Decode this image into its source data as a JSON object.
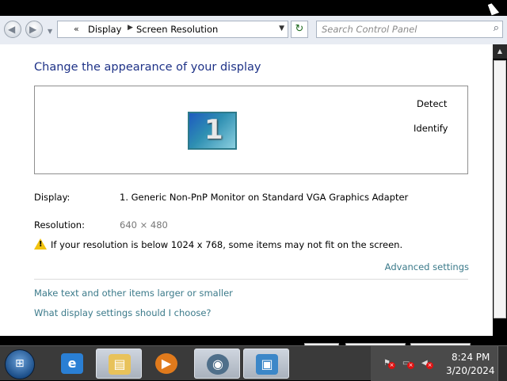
{
  "address_bar": {
    "chevrons": "«",
    "breadcrumbs": [
      "Display",
      "Screen Resolution"
    ],
    "search_placeholder": "Search Control Panel"
  },
  "main": {
    "heading": "Change the appearance of your display",
    "preview": {
      "monitor_number": "1",
      "detect_label": "Detect",
      "identify_label": "Identify"
    },
    "display_label": "Display:",
    "display_value": "1. Generic Non-PnP Monitor on Standard VGA Graphics Adapter",
    "resolution_label": "Resolution:",
    "resolution_value": "640 × 480",
    "warning": "If your resolution is below 1024 x 768, some items may not fit on the screen.",
    "advanced_settings": "Advanced settings",
    "links": [
      "Make text and other items larger or smaller",
      "What display settings should I choose?"
    ]
  },
  "taskbar": {
    "icons": [
      "internet-explorer-icon",
      "windows-explorer-icon",
      "media-player-icon",
      "network-icon",
      "display-settings-icon"
    ],
    "clock_time": "8:24 PM",
    "clock_date": "3/20/2024"
  },
  "colors": {
    "heading": "#1e3287",
    "link": "#3b7a8a",
    "taskbar": "#3a3a3a"
  }
}
